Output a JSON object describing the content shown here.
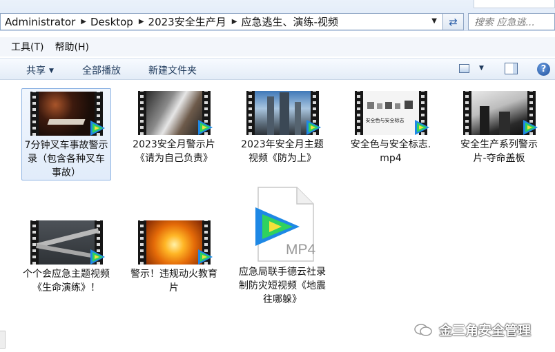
{
  "address_bar": {
    "crumbs": [
      "Administrator",
      "Desktop",
      "2023安全生产月",
      "应急逃生、演练-视频"
    ],
    "refresh_icon": "refresh-icon"
  },
  "search": {
    "placeholder": "搜索 应急逃..."
  },
  "menu": {
    "items": [
      "工具(T)",
      "帮助(H)"
    ]
  },
  "toolbar": {
    "share_label": "共享",
    "play_all_label": "全部播放",
    "new_folder_label": "新建文件夹"
  },
  "files": [
    {
      "name": "7分钟叉车事故警示录（包含各种叉车事故）",
      "selected": true,
      "theme": "fire-dark"
    },
    {
      "name": "2023安全月警示片《请为自己负责》",
      "selected": false,
      "theme": "worker"
    },
    {
      "name": "2023年安全月主题视频《防为上》",
      "selected": false,
      "theme": "city"
    },
    {
      "name": "安全色与安全标志.mp4",
      "selected": false,
      "theme": "signs"
    },
    {
      "name": "安全生产系列警示片-夺命盖板",
      "selected": false,
      "theme": "bw"
    },
    {
      "name": "个个会应急主题视频《生命演练》！",
      "selected": false,
      "theme": "bridge"
    },
    {
      "name": "警示！违规动火教育片",
      "selected": false,
      "theme": "flame"
    },
    {
      "name": "应急局联手德云社录制防灾短视频《地震往哪躲》",
      "selected": false,
      "theme": "mp4-doc"
    }
  ],
  "signs_thumb_text": "安全色与安全标志",
  "mp4_label": "MP4",
  "watermark": {
    "text": "金三角安全管理"
  }
}
